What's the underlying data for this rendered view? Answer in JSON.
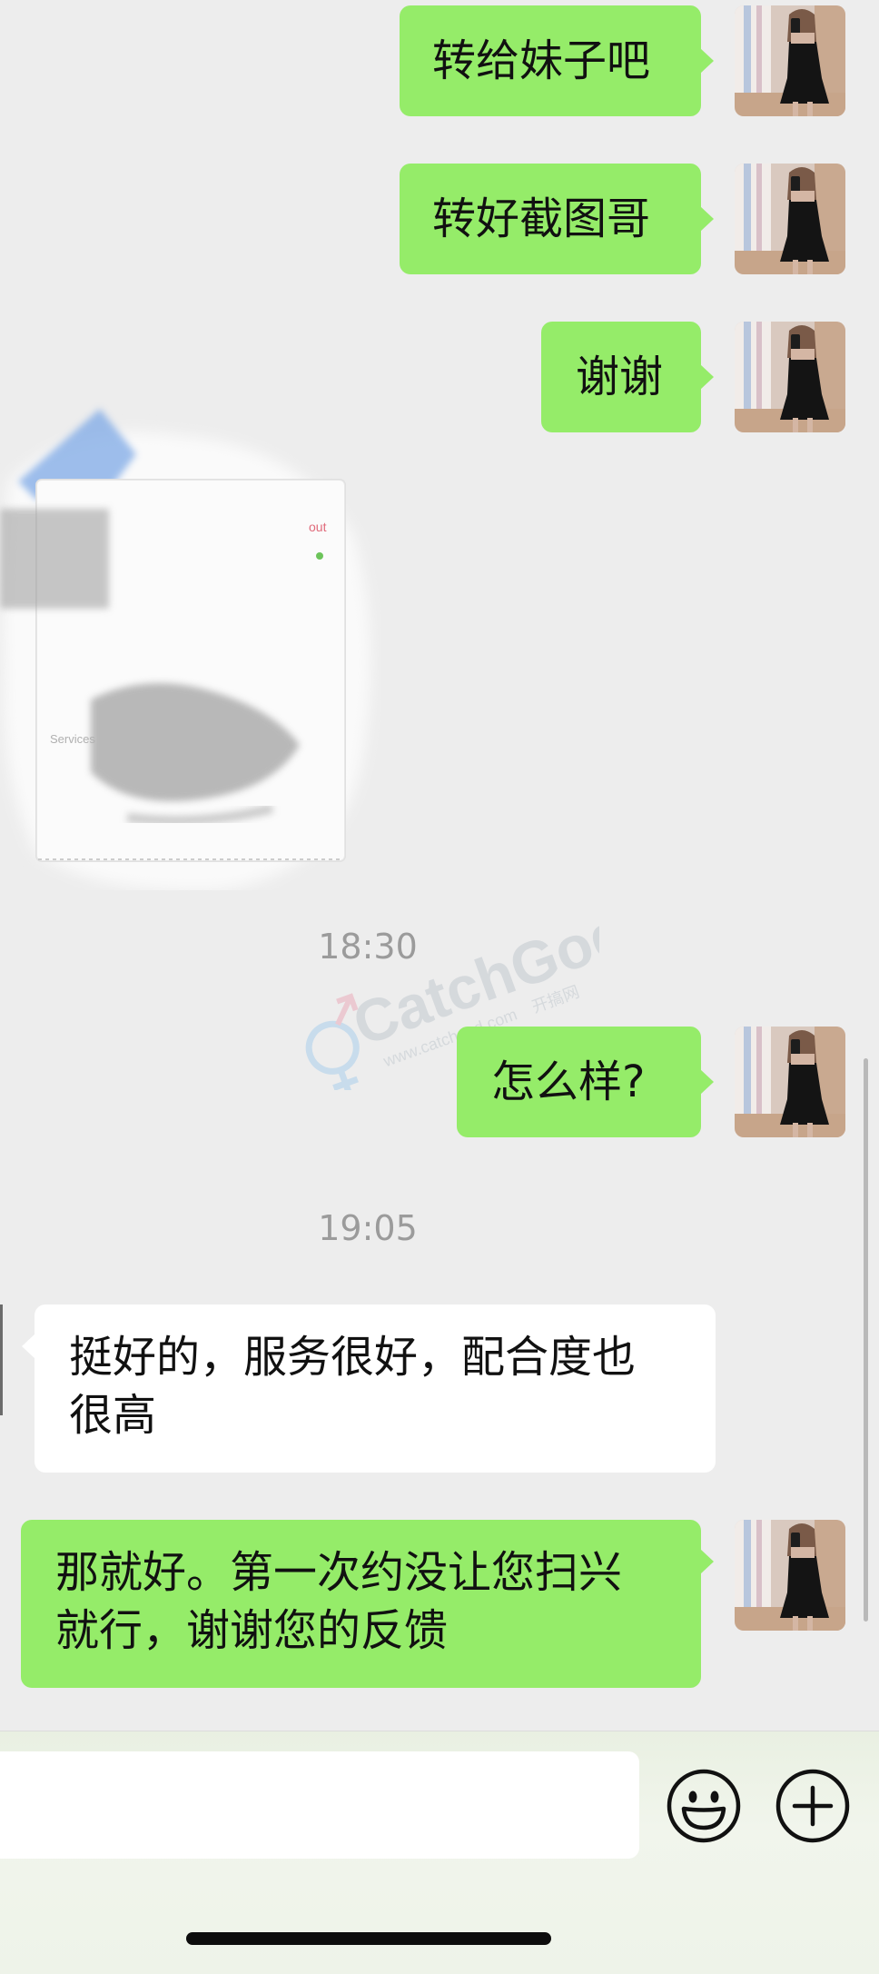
{
  "messages": [
    {
      "id": "m1",
      "side": "me",
      "text": "转给妹子吧"
    },
    {
      "id": "m2",
      "side": "me",
      "text": "转好截图哥"
    },
    {
      "id": "m3",
      "side": "me",
      "text": "谢谢"
    },
    {
      "id": "m4",
      "side": "them",
      "type": "image",
      "image_text": {
        "out_label": "out",
        "services_label": "Services"
      }
    },
    {
      "id": "t1",
      "type": "timestamp",
      "text": "18:30"
    },
    {
      "id": "m5",
      "side": "me",
      "text": "怎么样?"
    },
    {
      "id": "t2",
      "type": "timestamp",
      "text": "19:05"
    },
    {
      "id": "m6",
      "side": "them",
      "text_line1": "挺好的，服务很好，配合度也",
      "text_line2": "很高"
    },
    {
      "id": "m7",
      "side": "me",
      "text_line1": "那就好。第一次约没让您扫兴",
      "text_line2": "就行，谢谢您的反馈"
    }
  ],
  "watermark": {
    "brand": "CatchGod",
    "url": "www.catchgod.com",
    "cn_name": "开搞网"
  },
  "input_bar": {
    "emoji_icon": "smiley-face-icon",
    "plus_icon": "plus-circle-icon"
  },
  "colors": {
    "background": "#ededed",
    "my_bubble": "#95ec69",
    "their_bubble": "#ffffff",
    "timestamp_text": "#9b9b9b"
  }
}
